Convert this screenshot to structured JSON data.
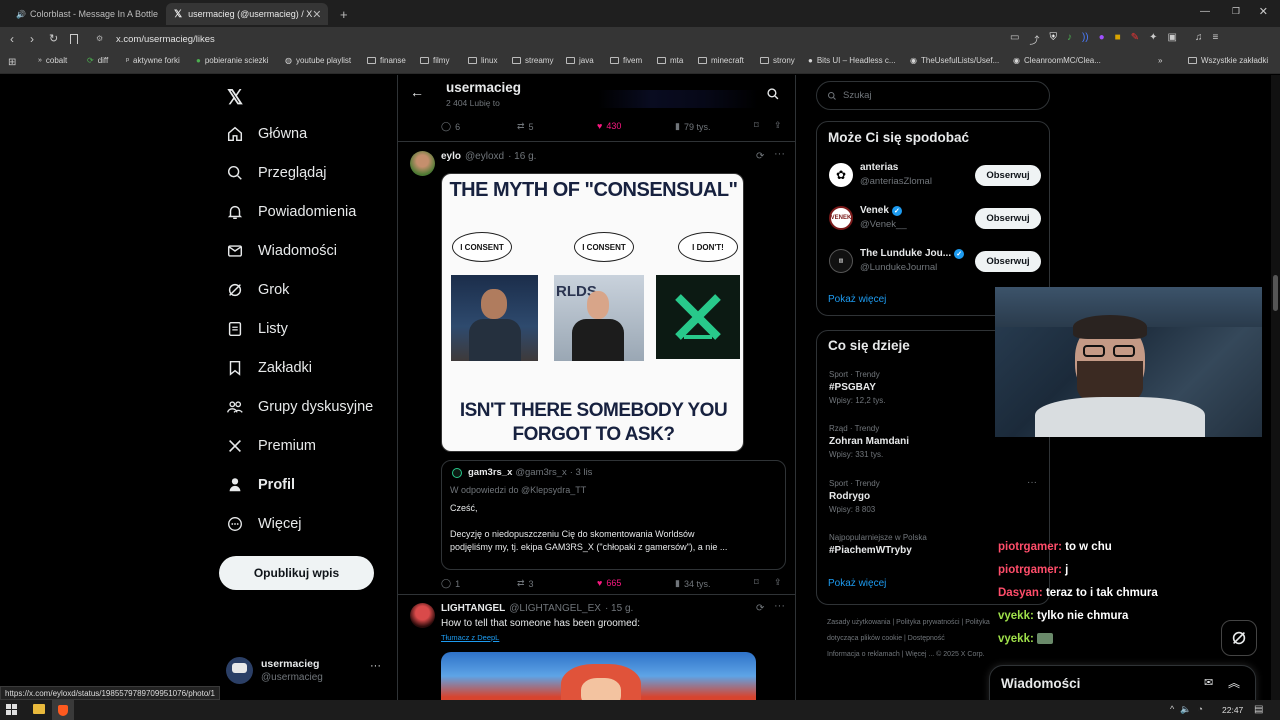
{
  "browser": {
    "tabs": [
      {
        "title": "Colorblast - Message In A Bottle"
      },
      {
        "title": "usermacieg (@usermacieg) / X"
      }
    ],
    "url": "x.com/usermacieg/likes",
    "bookmarks": [
      "cobalt",
      "diff",
      "aktywne forki",
      "pobieranie sciezki",
      "youtube playlist",
      "finanse",
      "filmy",
      "linux",
      "streamy",
      "java",
      "fivem",
      "mta",
      "minecraft",
      "strony",
      "Bits UI – Headless c...",
      "TheUsefulLists/Usef...",
      "CleanroomMC/Clea..."
    ],
    "other_bookmarks": "Wszystkie zakładki",
    "status_url": "https://x.com/eyloxd/status/1985579789709951076/photo/1"
  },
  "nav": {
    "items": [
      "Główna",
      "Przeglądaj",
      "Powiadomienia",
      "Wiadomości",
      "Grok",
      "Listy",
      "Zakładki",
      "Grupy dyskusyjne",
      "Premium",
      "Profil",
      "Więcej"
    ],
    "post_button": "Opublikuj wpis",
    "account_name": "usermacieg",
    "account_handle": "@usermacieg",
    "account_more": "···"
  },
  "header": {
    "title": "usermacieg",
    "subtitle": "2 404 Lubię to"
  },
  "prev_post_stats": {
    "replies": "6",
    "reposts": "5",
    "likes": "430",
    "views": "79 tys."
  },
  "post1": {
    "author": "eylo",
    "handle": "@eyloxd",
    "time": "· 16 g.",
    "meme_top": "THE MYTH OF \"CONSENSUAL\"",
    "bubble1": "I CONSENT",
    "bubble2": "I CONSENT",
    "bubble3": "I DON'T!",
    "meme_bottom": "ISN'T THERE SOMEBODY YOU FORGOT TO ASK?",
    "quote_author": "gam3rs_x",
    "quote_handle": "@gam3rs_x",
    "quote_time": "· 3 lis",
    "quote_reply_to": "W odpowiedzi do @Klepsydra_TT",
    "quote_line1": "Cześć,",
    "quote_line2": "Decyzję o niedopuszczeniu Cię do skomentowania Worldsów",
    "quote_line3": "podjęliśmy my, tj. ekipa GAM3RS_X (\"chłopaki z gamersów\"), a nie ...",
    "stats": {
      "replies": "1",
      "reposts": "3",
      "likes": "665",
      "views": "34 tys."
    }
  },
  "post2": {
    "author": "LIGHTANGEL",
    "handle": "@LIGHTANGEL_EX",
    "time": "· 15 g.",
    "text": "How to tell that someone has been groomed:",
    "translate": "Tłumacz z DeepL"
  },
  "search": {
    "placeholder": "Szukaj"
  },
  "suggestions": {
    "title": "Może Ci się spodobać",
    "items": [
      {
        "name": "anterias",
        "handle": "@anteriasZlomal",
        "button": "Obserwuj"
      },
      {
        "name": "Venek",
        "handle": "@Venek__",
        "button": "Obserwuj"
      },
      {
        "name": "The Lunduke Jou...",
        "handle": "@LundukeJournal",
        "button": "Obserwuj"
      }
    ],
    "more": "Pokaż więcej"
  },
  "trends": {
    "title": "Co się dzieje",
    "items": [
      {
        "category": "Sport · Trendy",
        "name": "#PSGBAY",
        "count": "Wpisy: 12,2 tys."
      },
      {
        "category": "Rząd · Trendy",
        "name": "Zohran Mamdani",
        "count": "Wpisy: 331 tys."
      },
      {
        "category": "Sport · Trendy",
        "name": "Rodrygo",
        "count": "Wpisy: 8 803"
      },
      {
        "category": "Najpopularniejsze w Polska",
        "name": "#PiachemWTryby",
        "count": ""
      }
    ],
    "more": "Pokaż więcej"
  },
  "footer": {
    "line1": "Zasady użytkowania | Polityka prywatności | Polityka dotycząca plików cookie | Dostępność",
    "line2": "Informacja o reklamach | Więcej ... © 2025 X Corp."
  },
  "chat": [
    {
      "user": "piotrgamer:",
      "msg": "to w chu",
      "color": "#ff4d6a"
    },
    {
      "user": "piotrgamer:",
      "msg": "j",
      "color": "#ff4d6a"
    },
    {
      "user": "Dasyan:",
      "msg": "teraz to i tak chmura",
      "color": "#ff4d6a"
    },
    {
      "user": "vyekk:",
      "msg": "tylko nie chmura",
      "color": "#9fe04a"
    },
    {
      "user": "vyekk:",
      "msg": "",
      "color": "#9fe04a"
    }
  ],
  "messages_drawer": {
    "title": "Wiadomości"
  },
  "taskbar": {
    "time": "22:47"
  },
  "colors": {
    "accent": "#1d9bf0",
    "like": "#f91880",
    "bg": "#000000"
  }
}
